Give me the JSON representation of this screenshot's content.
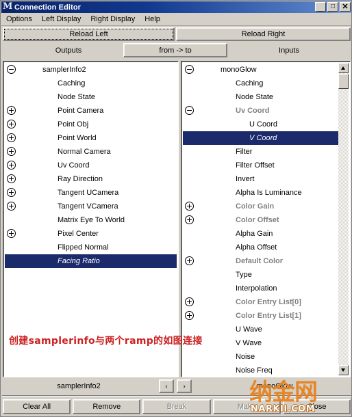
{
  "window": {
    "title": "Connection Editor",
    "icon": "maya-m-icon",
    "minimize_label": "_",
    "maximize_label": "□",
    "close_label": "✕"
  },
  "menubar": {
    "items": [
      {
        "label": "Options"
      },
      {
        "label": "Left Display"
      },
      {
        "label": "Right Display"
      },
      {
        "label": "Help"
      }
    ]
  },
  "toolbar": {
    "reload_left_label": "Reload Left",
    "reload_right_label": "Reload Right"
  },
  "columns": {
    "outputs_label": "Outputs",
    "from_to_label": "from -> to",
    "inputs_label": "Inputs"
  },
  "left_panel": {
    "root": "samplerInfo2",
    "rows": [
      {
        "label": "samplerInfo2",
        "depth": 0,
        "toggle": "minus",
        "group": false,
        "selected": false
      },
      {
        "label": "Caching",
        "depth": 1,
        "toggle": "none",
        "group": false,
        "selected": false
      },
      {
        "label": "Node State",
        "depth": 1,
        "toggle": "none",
        "group": false,
        "selected": false
      },
      {
        "label": "Point Camera",
        "depth": 1,
        "toggle": "plus",
        "group": false,
        "selected": false
      },
      {
        "label": "Point Obj",
        "depth": 1,
        "toggle": "plus",
        "group": false,
        "selected": false
      },
      {
        "label": "Point World",
        "depth": 1,
        "toggle": "plus",
        "group": false,
        "selected": false
      },
      {
        "label": "Normal Camera",
        "depth": 1,
        "toggle": "plus",
        "group": false,
        "selected": false
      },
      {
        "label": "Uv Coord",
        "depth": 1,
        "toggle": "plus",
        "group": false,
        "selected": false
      },
      {
        "label": "Ray Direction",
        "depth": 1,
        "toggle": "plus",
        "group": false,
        "selected": false
      },
      {
        "label": "Tangent UCamera",
        "depth": 1,
        "toggle": "plus",
        "group": false,
        "selected": false
      },
      {
        "label": "Tangent VCamera",
        "depth": 1,
        "toggle": "plus",
        "group": false,
        "selected": false
      },
      {
        "label": "Matrix Eye To World",
        "depth": 1,
        "toggle": "none",
        "group": false,
        "selected": false
      },
      {
        "label": "Pixel Center",
        "depth": 1,
        "toggle": "plus",
        "group": false,
        "selected": false
      },
      {
        "label": "Flipped Normal",
        "depth": 1,
        "toggle": "none",
        "group": false,
        "selected": false
      },
      {
        "label": "Facing Ratio",
        "depth": 1,
        "toggle": "none",
        "group": false,
        "selected": true
      }
    ]
  },
  "right_panel": {
    "root": "monoGlow",
    "rows": [
      {
        "label": "monoGlow",
        "depth": 0,
        "toggle": "minus",
        "group": false,
        "selected": false
      },
      {
        "label": "Caching",
        "depth": 1,
        "toggle": "none",
        "group": false,
        "selected": false
      },
      {
        "label": "Node State",
        "depth": 1,
        "toggle": "none",
        "group": false,
        "selected": false
      },
      {
        "label": "Uv Coord",
        "depth": 1,
        "toggle": "minus",
        "group": true,
        "selected": false
      },
      {
        "label": "U Coord",
        "depth": 2,
        "toggle": "none",
        "group": false,
        "selected": false
      },
      {
        "label": "V Coord",
        "depth": 2,
        "toggle": "none",
        "group": false,
        "selected": true
      },
      {
        "label": "Filter",
        "depth": 1,
        "toggle": "none",
        "group": false,
        "selected": false
      },
      {
        "label": "Filter Offset",
        "depth": 1,
        "toggle": "none",
        "group": false,
        "selected": false
      },
      {
        "label": "Invert",
        "depth": 1,
        "toggle": "none",
        "group": false,
        "selected": false
      },
      {
        "label": "Alpha Is Luminance",
        "depth": 1,
        "toggle": "none",
        "group": false,
        "selected": false
      },
      {
        "label": "Color Gain",
        "depth": 1,
        "toggle": "plus",
        "group": true,
        "selected": false
      },
      {
        "label": "Color Offset",
        "depth": 1,
        "toggle": "plus",
        "group": true,
        "selected": false
      },
      {
        "label": "Alpha Gain",
        "depth": 1,
        "toggle": "none",
        "group": false,
        "selected": false
      },
      {
        "label": "Alpha Offset",
        "depth": 1,
        "toggle": "none",
        "group": false,
        "selected": false
      },
      {
        "label": "Default Color",
        "depth": 1,
        "toggle": "plus",
        "group": true,
        "selected": false
      },
      {
        "label": "Type",
        "depth": 1,
        "toggle": "none",
        "group": false,
        "selected": false
      },
      {
        "label": "Interpolation",
        "depth": 1,
        "toggle": "none",
        "group": false,
        "selected": false
      },
      {
        "label": "Color Entry List[0]",
        "depth": 1,
        "toggle": "plus",
        "group": true,
        "selected": false
      },
      {
        "label": "Color Entry List[1]",
        "depth": 1,
        "toggle": "plus",
        "group": true,
        "selected": false
      },
      {
        "label": "U Wave",
        "depth": 1,
        "toggle": "none",
        "group": false,
        "selected": false
      },
      {
        "label": "V Wave",
        "depth": 1,
        "toggle": "none",
        "group": false,
        "selected": false
      },
      {
        "label": "Noise",
        "depth": 1,
        "toggle": "none",
        "group": false,
        "selected": false
      },
      {
        "label": "Noise Freq",
        "depth": 1,
        "toggle": "none",
        "group": false,
        "selected": false
      }
    ]
  },
  "annotation": {
    "text": "创建samplerinfo与两个ramp的如图连接",
    "color": "#cc2222"
  },
  "footer": {
    "left_name": "samplerInfo2",
    "right_name": "monoGlow",
    "prev_label": "‹",
    "next_label": "›",
    "buttons": [
      {
        "label": "Clear All",
        "disabled": false
      },
      {
        "label": "Remove",
        "disabled": false
      },
      {
        "label": "Break",
        "disabled": true
      },
      {
        "label": "Make",
        "disabled": true
      },
      {
        "label": "Close",
        "disabled": false
      }
    ]
  },
  "watermark": {
    "cn": "纳金网",
    "en": "NARKII.COM",
    "color": "#e8811a"
  }
}
